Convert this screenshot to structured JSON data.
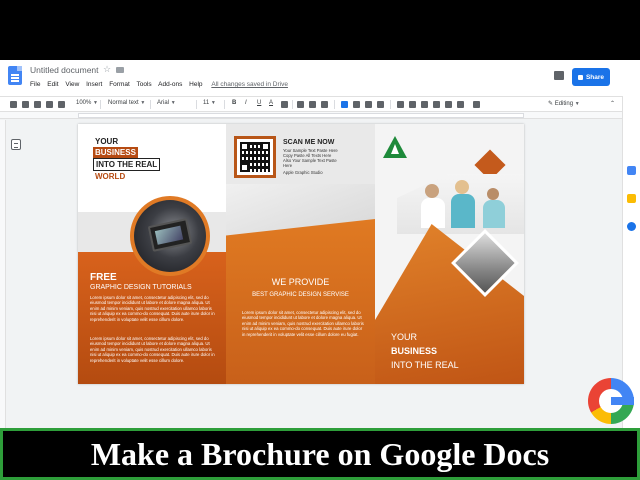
{
  "doc": {
    "title": "Untitled document",
    "menus": [
      "File",
      "Edit",
      "View",
      "Insert",
      "Format",
      "Tools",
      "Add-ons",
      "Help"
    ],
    "saved_status": "All changes saved in Drive",
    "share_label": "Share"
  },
  "toolbar": {
    "zoom": "100%",
    "style": "Normal text",
    "font": "Arial",
    "size": "11",
    "bold": "B",
    "italic": "I",
    "underline": "U",
    "text_color": "A",
    "mode": "Editing"
  },
  "brochure": {
    "panel1": {
      "heading_lines": [
        "YOUR",
        "BUSINESS",
        "INTO THE REAL",
        "WORLD"
      ],
      "free": "FREE",
      "free_sub": "GRAPHIC DESIGN TUTORIALS",
      "para1": "Lorem ipsum dolor sit amet, consectetur adipiscing elit, sed do eiusmod tempor incididunt ut labore et dolore magna aliqua. Ut enim ad minim veniam, quis nostrud exercitation ullamco laboris nisi ut aliquip ex ea commo-do consequat. Duis aute irure dolor in reprehenderit in voluptate velit esse cillum dolore.",
      "para2": "Lorem ipsum dolor sit amet, consectetur adipiscing elit, sed do eiusmod tempor incididunt ut labore et dolore magna aliqua. Ut enim ad minim veniam, quis nostrud exercitation ullamco laboris nisi ut aliquip ex ea commo-do consequat. Duis aute irure dolor in reprehenderit in voluptate velit esse cillum dolore."
    },
    "panel2": {
      "scan_title": "SCAN ME NOW",
      "scan_lines": [
        "Your Sample Text Paste Here",
        "Copy Paste All Texts Here",
        "Also Your Sample Text Paste",
        "Here",
        "Apple Graphic Studio"
      ],
      "we_provide": "WE PROVIDE",
      "best": "BEST GRAPHIC DESIGN SERVISE",
      "para": "Lorem ipsum dolor sit amet, consectetur adipiscing elit, sed do eiusmod tempor incididunt ut labore et dolore magna aliqua. Ut enim ad minim veniam, quis nostrud exercitation ullamco laboris nisi ut aliquip ex ea commo-do consequat. Duis aute irure dolor in reprehenderit in voluptate velit esse cillum dolore eu fugiat."
    },
    "panel3": {
      "your": "YOUR",
      "business": "BUSINESS",
      "into": "INTO THE REAL"
    }
  },
  "caption": "Make a Brochure on Google Docs",
  "colors": {
    "orange": "#c8601a",
    "share_blue": "#1a73e8",
    "caption_border": "#2e9e3a"
  }
}
